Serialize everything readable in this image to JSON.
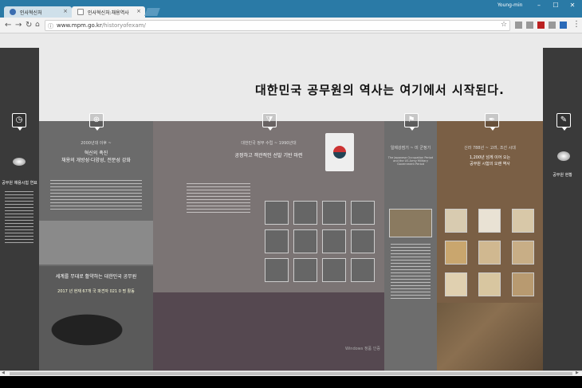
{
  "browser": {
    "tabs": [
      {
        "label": "인사혁신처",
        "active": false
      },
      {
        "label": "인사혁신처:채용역사",
        "active": true
      }
    ],
    "profile": "Young-min",
    "url_host": "www.mpm.go.kr",
    "url_path": "/historyofexam/",
    "window_buttons": [
      "–",
      "☐",
      "✕"
    ]
  },
  "page": {
    "headline": "대한민국 공무원의 역사는 여기에서 시작된다.",
    "left_side_label": "공무원 채용시험 연표",
    "right_side_label": "공무원 현황",
    "sections": [
      {
        "icon": "globe-icon",
        "era": "2000년대 이후 ~",
        "title": "혁신의 촉진\n채용의 개방성·다양성, 전문성 강화",
        "world_title": "세계를 무대로 활약하는 대한민국 공무원",
        "world_sub": "2017 년 현재 67개 국 파견자 021 0 명 활동"
      },
      {
        "icon": "filter-icon",
        "era": "대한민국 정부 수립 ~ 1990년대",
        "title": "공정하고 객관적인 선발 기반 마련"
      },
      {
        "icon": "flag-icon",
        "era": "일제강점기 ~ 미 군정기",
        "title": "The Japanese Occupation Period and the US Army Military Government Period"
      },
      {
        "icon": "pen-icon",
        "era": "신라 788년 ~ 고려, 조선 시대",
        "title": "1,200년 넘게 이어 오는\n공무원 시험의 오랜 역사"
      }
    ],
    "watermark": "Windows 정품 인증"
  },
  "colors": {
    "titlebar": "#2a7aa6",
    "sidebar": "#3a3a3a",
    "section_gray": "#6a6a6a",
    "section_brown": "#7a5f45"
  }
}
